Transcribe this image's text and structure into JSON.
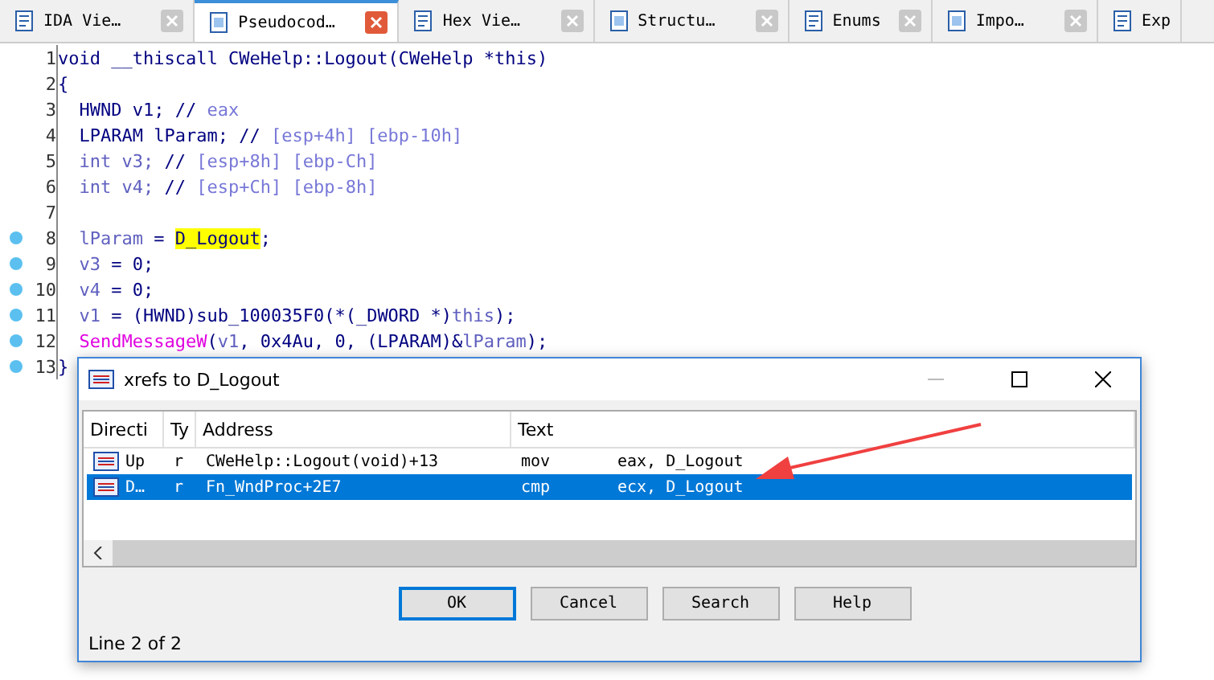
{
  "tabs": [
    {
      "label": "IDA Vie…",
      "selected": false,
      "closable": true
    },
    {
      "label": "Pseudocod…",
      "selected": true,
      "closable": true
    },
    {
      "label": "Hex Vie…",
      "selected": false,
      "closable": true
    },
    {
      "label": "Structu…",
      "selected": false,
      "closable": true
    },
    {
      "label": "Enums",
      "selected": false,
      "closable": true
    },
    {
      "label": "Impo…",
      "selected": false,
      "closable": true
    },
    {
      "label": "Exp",
      "selected": false,
      "closable": false
    }
  ],
  "code": [
    {
      "number": "1",
      "breakpoint": false,
      "segments": [
        {
          "kind": "plain",
          "text": "void __thiscall CWeHelp::Logout(CWeHelp *this)"
        }
      ]
    },
    {
      "number": "2",
      "breakpoint": false,
      "segments": [
        {
          "kind": "plain",
          "text": "{"
        }
      ]
    },
    {
      "number": "3",
      "breakpoint": false,
      "segments": [
        {
          "kind": "plain",
          "text": "  HWND v1; // "
        },
        {
          "kind": "comment",
          "text": "eax"
        }
      ]
    },
    {
      "number": "4",
      "breakpoint": false,
      "segments": [
        {
          "kind": "plain",
          "text": "  LPARAM lParam; // "
        },
        {
          "kind": "comment",
          "text": "[esp+4h] [ebp-10h]"
        }
      ]
    },
    {
      "number": "5",
      "breakpoint": false,
      "segments": [
        {
          "kind": "local",
          "text": "  int v3; "
        },
        {
          "kind": "plain",
          "text": "// "
        },
        {
          "kind": "comment",
          "text": "[esp+8h] [ebp-Ch]"
        }
      ]
    },
    {
      "number": "6",
      "breakpoint": false,
      "segments": [
        {
          "kind": "local",
          "text": "  int v4; "
        },
        {
          "kind": "plain",
          "text": "// "
        },
        {
          "kind": "comment",
          "text": "[esp+Ch] [ebp-8h]"
        }
      ]
    },
    {
      "number": "7",
      "breakpoint": false
    },
    {
      "number": "8",
      "breakpoint": true,
      "segments": [
        {
          "kind": "local",
          "text": "  lParam "
        },
        {
          "kind": "plain",
          "text": "= "
        },
        {
          "kind": "highlight",
          "text": "D_Logout"
        },
        {
          "kind": "plain",
          "text": ";"
        }
      ]
    },
    {
      "number": "9",
      "breakpoint": true,
      "segments": [
        {
          "kind": "local",
          "text": "  v3 "
        },
        {
          "kind": "plain",
          "text": "= 0;"
        }
      ]
    },
    {
      "number": "10",
      "breakpoint": true,
      "segments": [
        {
          "kind": "local",
          "text": "  v4 "
        },
        {
          "kind": "plain",
          "text": "= 0;"
        }
      ]
    },
    {
      "number": "11",
      "breakpoint": true,
      "segments": [
        {
          "kind": "local",
          "text": "  v1 "
        },
        {
          "kind": "plain",
          "text": "= (HWND)sub_100035F0(*(_DWORD *)"
        },
        {
          "kind": "local",
          "text": "this"
        },
        {
          "kind": "plain",
          "text": ");"
        }
      ]
    },
    {
      "number": "12",
      "breakpoint": true,
      "segments": [
        {
          "kind": "import",
          "text": "  SendMessageW"
        },
        {
          "kind": "plain",
          "text": "("
        },
        {
          "kind": "local",
          "text": "v1"
        },
        {
          "kind": "plain",
          "text": ", 0x4Au, 0, (LPARAM)&"
        },
        {
          "kind": "local",
          "text": "lParam"
        },
        {
          "kind": "plain",
          "text": ");"
        }
      ]
    },
    {
      "number": "13",
      "breakpoint": true,
      "segments": [
        {
          "kind": "plain",
          "text": "}"
        }
      ]
    }
  ],
  "dialog": {
    "title": "xrefs to D_Logout",
    "columns": [
      "Directi",
      "Ty",
      "Address",
      "Text"
    ],
    "rows": [
      {
        "direction": "Up",
        "type": "r",
        "address": "CWeHelp::Logout(void)+13",
        "mnemonic": "mov",
        "operands": "eax, D_Logout",
        "selected": false
      },
      {
        "direction": "D…",
        "type": "r",
        "address": "Fn_WndProc+2E7",
        "mnemonic": "cmp",
        "operands": "ecx, D_Logout",
        "selected": true
      }
    ],
    "buttons": [
      {
        "label": "OK",
        "default": true
      },
      {
        "label": "Cancel",
        "default": false
      },
      {
        "label": "Search",
        "default": false
      },
      {
        "label": "Help",
        "default": false
      }
    ],
    "status": "Line 2 of 2"
  }
}
